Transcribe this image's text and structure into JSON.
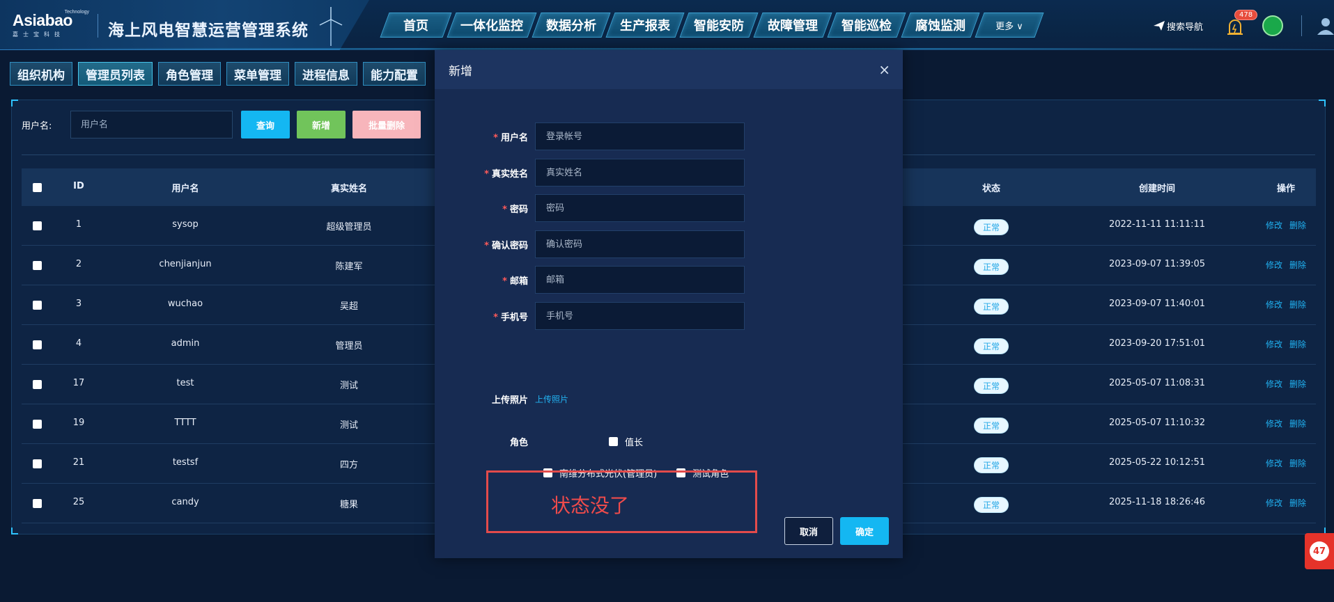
{
  "header": {
    "logo_brand": "Asiabao",
    "logo_tech": "Technology",
    "logo_cn": "嘉士宝科技",
    "system_title": "海上风电智慧运营管理系统",
    "nav": [
      {
        "label": "首页"
      },
      {
        "label": "一体化监控"
      },
      {
        "label": "数据分析"
      },
      {
        "label": "生产报表"
      },
      {
        "label": "智能安防"
      },
      {
        "label": "故障管理"
      },
      {
        "label": "智能巡检"
      },
      {
        "label": "腐蚀监测"
      },
      {
        "label": "更多 ∨"
      }
    ],
    "search_nav": "搜索导航",
    "alarm_count": "478"
  },
  "subtabs": [
    {
      "label": "组织机构"
    },
    {
      "label": "管理员列表"
    },
    {
      "label": "角色管理"
    },
    {
      "label": "菜单管理"
    },
    {
      "label": "进程信息"
    },
    {
      "label": "能力配置"
    }
  ],
  "search": {
    "label": "用户名:",
    "placeholder": "用户名",
    "query_btn": "查询",
    "add_btn": "新增",
    "batch_delete_btn": "批量删除"
  },
  "table": {
    "headers": {
      "id": "ID",
      "username": "用户名",
      "realname": "真实姓名",
      "status": "状态",
      "created": "创建时间",
      "ops": "操作"
    },
    "rows": [
      {
        "id": "1",
        "username": "sysop",
        "realname": "超级管理员",
        "status": "正常",
        "created": "2022-11-11 11:11:11"
      },
      {
        "id": "2",
        "username": "chenjianjun",
        "realname": "陈建军",
        "status": "正常",
        "created": "2023-09-07 11:39:05"
      },
      {
        "id": "3",
        "username": "wuchao",
        "realname": "吴超",
        "status": "正常",
        "created": "2023-09-07 11:40:01"
      },
      {
        "id": "4",
        "username": "admin",
        "realname": "管理员",
        "status": "正常",
        "created": "2023-09-20 17:51:01"
      },
      {
        "id": "17",
        "username": "test",
        "realname": "测试",
        "status": "正常",
        "created": "2025-05-07 11:08:31"
      },
      {
        "id": "19",
        "username": "TTTT",
        "realname": "测试",
        "status": "正常",
        "created": "2025-05-07 11:10:32"
      },
      {
        "id": "21",
        "username": "testsf",
        "realname": "四方",
        "status": "正常",
        "created": "2025-05-22 10:12:51"
      },
      {
        "id": "25",
        "username": "candy",
        "realname": "糖果",
        "status": "正常",
        "created": "2025-11-18 18:26:46"
      }
    ],
    "edit_label": "修改",
    "delete_label": "删除"
  },
  "modal": {
    "title": "新增",
    "close": "×",
    "fields": [
      {
        "label": "用户名",
        "placeholder": "登录帐号",
        "required": true
      },
      {
        "label": "真实姓名",
        "placeholder": "真实姓名",
        "required": true
      },
      {
        "label": "密码",
        "placeholder": "密码",
        "required": true
      },
      {
        "label": "确认密码",
        "placeholder": "确认密码",
        "required": true
      },
      {
        "label": "邮箱",
        "placeholder": "邮箱",
        "required": true
      },
      {
        "label": "手机号",
        "placeholder": "手机号",
        "required": true
      }
    ],
    "upload_label": "上传照片",
    "upload_link": "上传照片",
    "role_label": "角色",
    "roles": [
      "值长",
      "南维分布式光伏(管理员)",
      "测试角色"
    ],
    "annotation": "状态没了",
    "cancel": "取消",
    "ok": "确定"
  },
  "float_badge": "47",
  "colors": {
    "accent": "#14b7f2",
    "add": "#71c45b",
    "danger_light": "#f7b5bb",
    "annotation": "#e34b4b"
  }
}
